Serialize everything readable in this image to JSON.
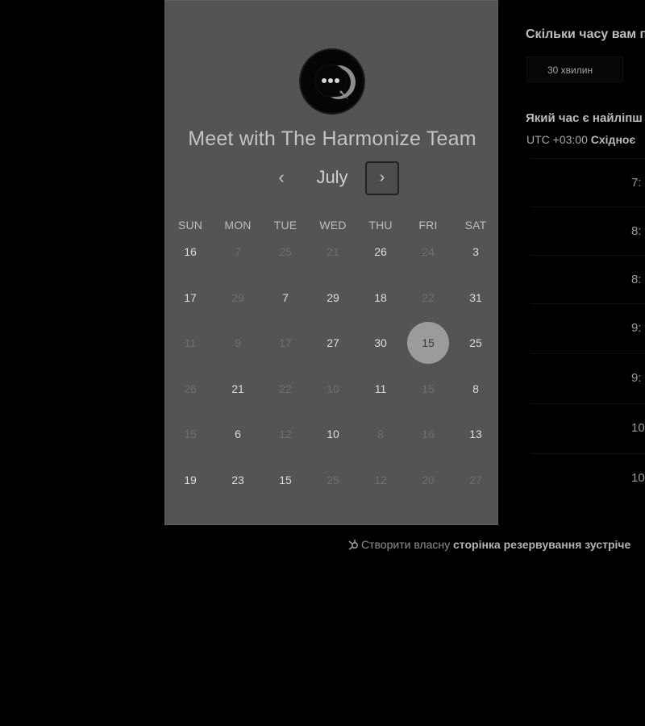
{
  "calendar": {
    "title": "Meet with The Harmonize Team",
    "month": "July",
    "prev_icon": "‹",
    "next_icon": "›",
    "weekdays": [
      "SUN",
      "MON",
      "TUE",
      "WED",
      "THU",
      "FRI",
      "SAT"
    ],
    "selected_day": "15",
    "weeks": [
      [
        {
          "d": "16",
          "e": true
        },
        {
          "d": "7",
          "e": false
        },
        {
          "d": "25",
          "e": false
        },
        {
          "d": "21",
          "e": false
        },
        {
          "d": "26",
          "e": true
        },
        {
          "d": "24",
          "e": false
        },
        {
          "d": "3",
          "e": true
        }
      ],
      [
        {
          "d": "17",
          "e": true
        },
        {
          "d": "29",
          "e": false
        },
        {
          "d": "7",
          "e": true
        },
        {
          "d": "29",
          "e": true
        },
        {
          "d": "18",
          "e": true
        },
        {
          "d": "22",
          "e": false
        },
        {
          "d": "31",
          "e": true
        }
      ],
      [
        {
          "d": "11",
          "e": false
        },
        {
          "d": "9",
          "e": false
        },
        {
          "d": "17",
          "e": false
        },
        {
          "d": "27",
          "e": true
        },
        {
          "d": "30",
          "e": true
        },
        {
          "d": "15",
          "e": true,
          "selected": true
        },
        {
          "d": "25",
          "e": true
        }
      ],
      [
        {
          "d": "26",
          "e": false
        },
        {
          "d": "21",
          "e": true
        },
        {
          "d": "22",
          "e": false
        },
        {
          "d": "10",
          "e": false
        },
        {
          "d": "11",
          "e": true
        },
        {
          "d": "15",
          "e": false
        },
        {
          "d": "8",
          "e": true
        }
      ],
      [
        {
          "d": "15",
          "e": false
        },
        {
          "d": "6",
          "e": true
        },
        {
          "d": "12",
          "e": false
        },
        {
          "d": "10",
          "e": true
        },
        {
          "d": "8",
          "e": false
        },
        {
          "d": "16",
          "e": false
        },
        {
          "d": "13",
          "e": true
        }
      ],
      [
        {
          "d": "19",
          "e": true
        },
        {
          "d": "23",
          "e": true
        },
        {
          "d": "15",
          "e": true
        },
        {
          "d": "25",
          "e": false
        },
        {
          "d": "12",
          "e": false
        },
        {
          "d": "20",
          "e": false
        },
        {
          "d": "27",
          "e": false
        }
      ]
    ]
  },
  "booking": {
    "duration_question": "Скільки часу вам п",
    "duration_value": "30 хвилин",
    "time_question": "Який час є найліпш",
    "timezone_prefix": "UTC +03:00 ",
    "timezone_name": "Східноє",
    "slots": [
      "7:",
      "8:",
      "8:",
      "9:",
      "9:",
      "10",
      "10"
    ]
  },
  "footer": {
    "prefix": "Створити власну ",
    "link": "сторінка резервування зустріче"
  },
  "colors": {
    "panel": "#545454",
    "selected_circle": "#9b9b9b",
    "background": "#000000"
  }
}
